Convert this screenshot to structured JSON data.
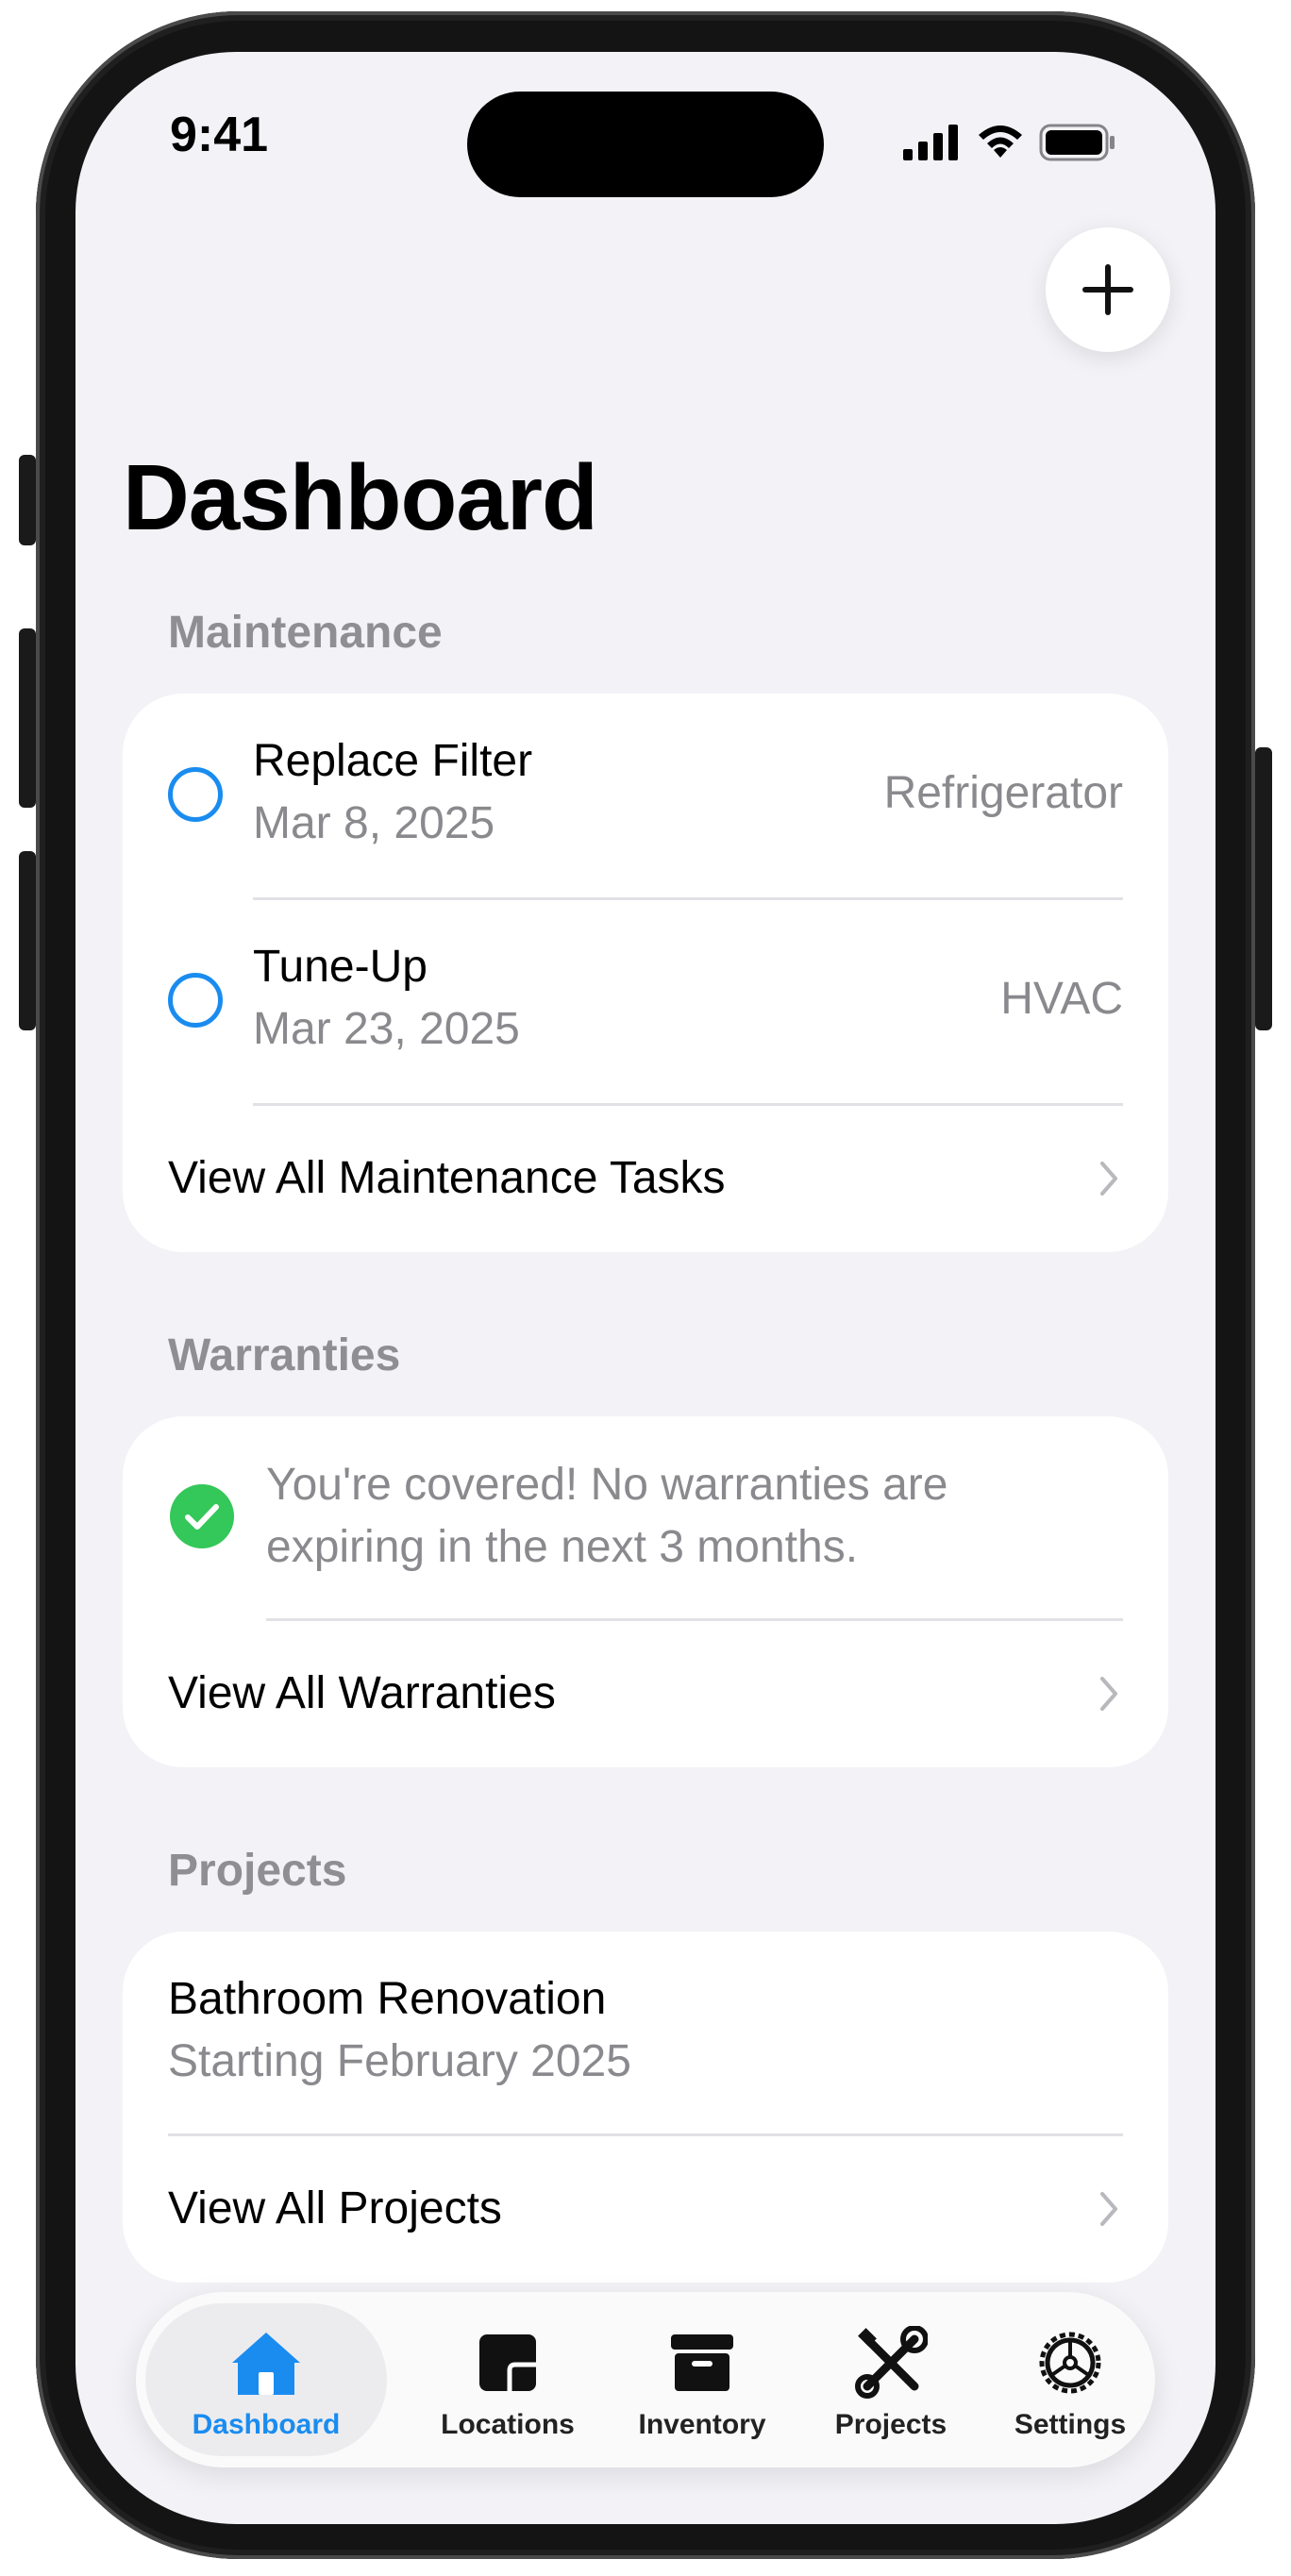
{
  "status_bar": {
    "time": "9:41"
  },
  "header": {
    "title": "Dashboard",
    "add_icon": "plus-icon"
  },
  "maintenance": {
    "label": "Maintenance",
    "tasks": [
      {
        "title": "Replace Filter",
        "date": "Mar 8, 2025",
        "item": "Refrigerator"
      },
      {
        "title": "Tune-Up",
        "date": "Mar 23, 2025",
        "item": "HVAC"
      }
    ],
    "view_all": "View All Maintenance Tasks"
  },
  "warranties": {
    "label": "Warranties",
    "message": "You're covered! No warranties are expiring in the next 3 months.",
    "view_all": "View All Warranties"
  },
  "projects": {
    "label": "Projects",
    "items": [
      {
        "title": "Bathroom Renovation",
        "subtitle": "Starting February 2025"
      }
    ],
    "view_all": "View All Projects"
  },
  "tab_bar": {
    "tabs": [
      {
        "label": "Dashboard",
        "icon": "house-icon",
        "active": true
      },
      {
        "label": "Locations",
        "icon": "floorplan-icon"
      },
      {
        "label": "Inventory",
        "icon": "archivebox-icon"
      },
      {
        "label": "Projects",
        "icon": "tools-icon"
      },
      {
        "label": "Settings",
        "icon": "gear-icon"
      }
    ]
  },
  "colors": {
    "accent": "#1a8cf0",
    "success": "#34c759",
    "background": "#f2f2f7",
    "secondary_text": "#8a8a8e"
  }
}
